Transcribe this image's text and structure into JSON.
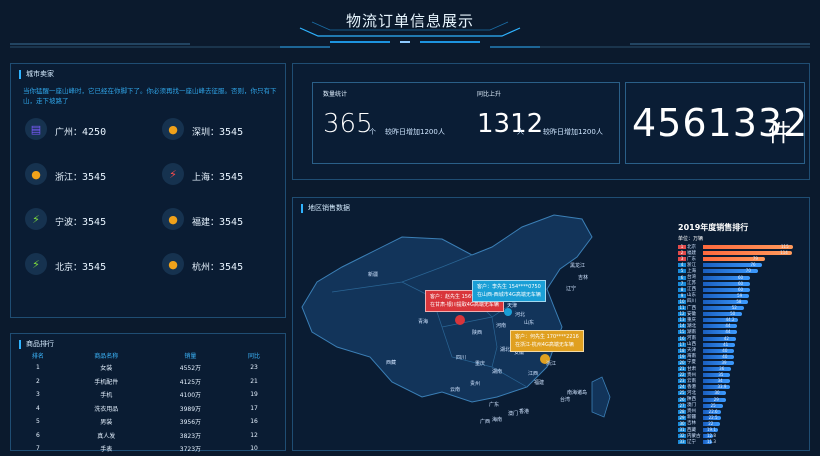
{
  "header": {
    "title": "物流订单信息展示"
  },
  "buyer_panel": {
    "title": "城市卖家",
    "notice": "当你猛醒一座山峰时，它已经在你脚下了。你必须再找一座山峰去征服。否则，你只有下山，走下坡路了",
    "cities": [
      {
        "name": "广州：",
        "value": "4250",
        "icon": "document-icon",
        "color": "#7b5cff"
      },
      {
        "name": "深圳：",
        "value": "3545",
        "icon": "bulb-icon",
        "color": "#f0a21a"
      },
      {
        "name": "浙江：",
        "value": "3545",
        "icon": "bulb-icon",
        "color": "#f0a21a"
      },
      {
        "name": "上海：",
        "value": "3545",
        "icon": "lightning-icon",
        "color": "#ff4d4d"
      },
      {
        "name": "宁波：",
        "value": "3545",
        "icon": "lightning-icon",
        "color": "#7ddc3c"
      },
      {
        "name": "福建：",
        "value": "3545",
        "icon": "bulb-icon",
        "color": "#f0a21a"
      },
      {
        "name": "北京：",
        "value": "3545",
        "icon": "lightning-icon",
        "color": "#7ddc3c"
      },
      {
        "name": "杭州：",
        "value": "3545",
        "icon": "bulb-icon",
        "color": "#f0a21a"
      }
    ]
  },
  "stats": {
    "count_label": "数量统计",
    "count_value": "365",
    "count_unit": "个",
    "count_compare": "较昨日增加1200人",
    "rise_label": "同比上升",
    "rise_value": "1312",
    "rise_unit": "人",
    "rise_compare": "较昨日增加1200人",
    "total_value": "4561332",
    "total_unit": "件"
  },
  "product_panel": {
    "title": "商品排行",
    "columns": [
      "排名",
      "商品名称",
      "销量",
      "同比"
    ],
    "rows": [
      [
        "1",
        "女装",
        "4552万",
        "23"
      ],
      [
        "2",
        "手机配件",
        "4125万",
        "21"
      ],
      [
        "3",
        "手机",
        "4100万",
        "19"
      ],
      [
        "4",
        "洗衣用品",
        "3989万",
        "17"
      ],
      [
        "5",
        "男装",
        "3956万",
        "16"
      ],
      [
        "6",
        "真人发",
        "3823万",
        "12"
      ],
      [
        "7",
        "手表",
        "3723万",
        "10"
      ]
    ]
  },
  "map_panel": {
    "title": "地区销售数据",
    "provinces": [
      "新疆",
      "西藏",
      "青海",
      "甘肃",
      "宁夏",
      "陕西",
      "四川",
      "重庆",
      "云南",
      "贵州",
      "湖南",
      "湖北",
      "河南",
      "山西",
      "河北",
      "山东",
      "内蒙古",
      "黑龙江",
      "辽宁",
      "吉林",
      "北京",
      "天津",
      "江苏",
      "安徽",
      "浙江",
      "江西",
      "福建",
      "广东",
      "广西",
      "海南",
      "台湾",
      "香港",
      "澳门",
      "南海诸岛"
    ],
    "tooltips": [
      {
        "line1": "客户：赵先生  156****5655",
        "line2": "在甘肃-银川提取4G高端无车辆",
        "color": "#d9353b"
      },
      {
        "line1": "客户：李先生  154****0750",
        "line2": "在山西-西城市4G高端无车辆",
        "color": "#1a9fd6"
      },
      {
        "line1": "客户：何先生  170****2216",
        "line2": "在浙江-杭州4G高端无车辆",
        "color": "#e0a020"
      }
    ]
  },
  "sales_rank": {
    "title": "2019年度销售排行",
    "unit": "单位：万辆",
    "items": [
      {
        "name": "北京",
        "value": 115
      },
      {
        "name": "福建",
        "value": 114
      },
      {
        "name": "广东",
        "value": 79
      },
      {
        "name": "浙江",
        "value": 76
      },
      {
        "name": "上海",
        "value": 70
      },
      {
        "name": "台湾",
        "value": 60
      },
      {
        "name": "江苏",
        "value": 60
      },
      {
        "name": "江西",
        "value": 60
      },
      {
        "name": "山东",
        "value": 59
      },
      {
        "name": "四川",
        "value": 58
      },
      {
        "name": "广西",
        "value": 52
      },
      {
        "name": "安徽",
        "value": 50
      },
      {
        "name": "重庆",
        "value": 44.2
      },
      {
        "name": "湖北",
        "value": 44
      },
      {
        "name": "湖南",
        "value": 44
      },
      {
        "name": "河南",
        "value": 42
      },
      {
        "name": "山西",
        "value": 41
      },
      {
        "name": "天津",
        "value": 40
      },
      {
        "name": "海南",
        "value": 40
      },
      {
        "name": "宁夏",
        "value": 39
      },
      {
        "name": "甘肃",
        "value": 36
      },
      {
        "name": "贵州",
        "value": 35
      },
      {
        "name": "云南",
        "value": 34
      },
      {
        "name": "香港",
        "value": 33.9
      },
      {
        "name": "河北",
        "value": 30
      },
      {
        "name": "陕西",
        "value": 29
      },
      {
        "name": "澳门",
        "value": 25
      },
      {
        "name": "贵州",
        "value": 22.6
      },
      {
        "name": "新疆",
        "value": 22.5
      },
      {
        "name": "吉林",
        "value": 22
      },
      {
        "name": "西藏",
        "value": 19.1
      },
      {
        "name": "内蒙古",
        "value": 12.8
      },
      {
        "name": "辽宁",
        "value": 11.3
      }
    ]
  }
}
